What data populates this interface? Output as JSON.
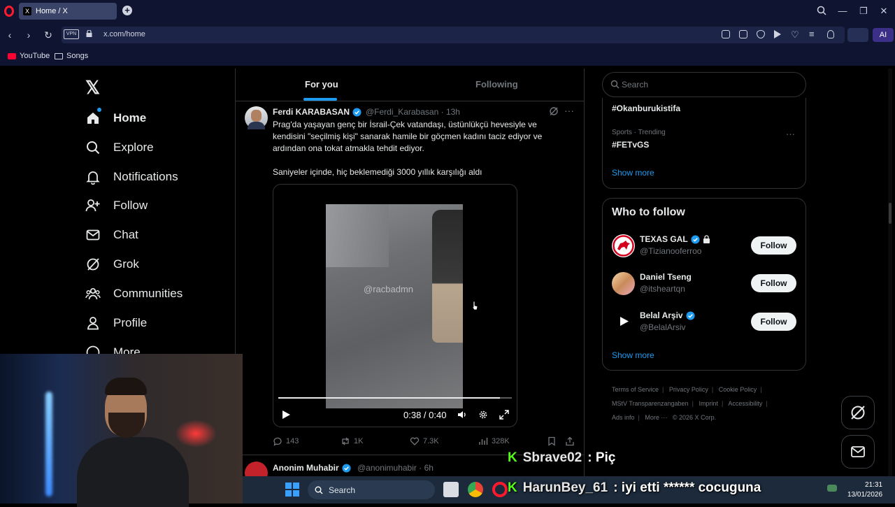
{
  "browser": {
    "tab_title": "Home / X",
    "tab_favicon": "X",
    "url": "x.com/home",
    "vpn_label": "VPN",
    "ai_label": "AI",
    "bookmarks": [
      {
        "label": "YouTube",
        "icon": "youtube-icon"
      },
      {
        "label": "Songs",
        "icon": "folder-icon"
      }
    ]
  },
  "nav": {
    "items": [
      {
        "label": "Home",
        "icon": "home-icon"
      },
      {
        "label": "Explore",
        "icon": "search-icon"
      },
      {
        "label": "Notifications",
        "icon": "bell-icon"
      },
      {
        "label": "Follow",
        "icon": "follow-icon"
      },
      {
        "label": "Chat",
        "icon": "mail-icon"
      },
      {
        "label": "Grok",
        "icon": "grok-icon"
      },
      {
        "label": "Communities",
        "icon": "communities-icon"
      },
      {
        "label": "Profile",
        "icon": "profile-icon"
      },
      {
        "label": "More",
        "icon": "more-icon"
      }
    ]
  },
  "timeline": {
    "tabs": [
      "For you",
      "Following"
    ],
    "tweet": {
      "name": "Ferdi KARABASAN",
      "handle": "@Ferdi_Karabasan",
      "time": "13h",
      "text": "Prag'da yaşayan genç bir İsrail-Çek vatandaşı, üstünlükçü hevesiyle ve kendisini \"seçilmiş kişi\" sanarak hamile bir göçmen kadını taciz ediyor ve ardından ona tokat atmakla tehdit ediyor.\n\nSaniyeler içinde, hiç beklemediği 3000 yıllık karşılığı  aldı",
      "video": {
        "watermark": "@racbadmn",
        "time": "0:38 / 0:40",
        "progress": 0.95
      },
      "replies": "143",
      "reposts": "1K",
      "likes": "7.3K",
      "views": "328K"
    },
    "tweet2": {
      "name": "Anonim Muhabir",
      "handle": "@anonimuhabir",
      "time": "6h"
    }
  },
  "sidebar": {
    "search_placeholder": "Search",
    "trends": [
      {
        "category": "",
        "name": "#Okanburukistifa"
      },
      {
        "category": "Sports · Trending",
        "name": "#FETvGS"
      }
    ],
    "show_more": "Show more",
    "who_to_follow_title": "Who to follow",
    "who_to_follow": [
      {
        "name": "TEXAS GAL",
        "handle": "@Tizianooferroo",
        "verified": true,
        "locked": true
      },
      {
        "name": "Daniel Tseng",
        "handle": "@itsheartqn",
        "verified": false,
        "locked": false
      },
      {
        "name": "Belal Arşiv",
        "handle": "@BelalArsiv",
        "verified": true,
        "locked": false
      }
    ],
    "follow_label": "Follow",
    "footer": [
      "Terms of Service",
      "Privacy Policy",
      "Cookie Policy",
      "MStV Transparenzangaben",
      "Imprint",
      "Accessibility",
      "Ads info",
      "More ···",
      "© 2026 X Corp."
    ]
  },
  "taskbar": {
    "search_label": "Search",
    "time": "21:31",
    "date": "13/01/2026"
  },
  "chat_overlay": [
    {
      "user": "Sbrave02",
      "message": ": Piç"
    },
    {
      "user": "HarunBey_61",
      "message": ": iyi etti ****** cocuguna"
    }
  ],
  "colors": {
    "accent": "#1d9bf0",
    "background": "#000000",
    "kick_green": "#53fc18"
  }
}
